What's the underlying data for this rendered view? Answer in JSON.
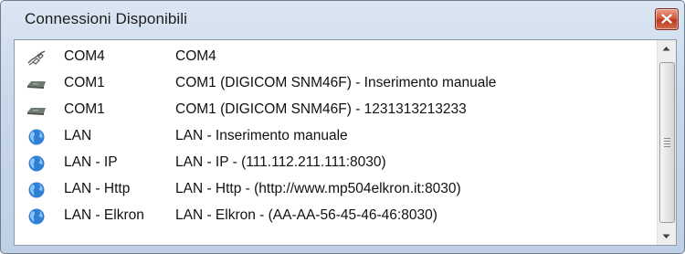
{
  "window": {
    "title": "Connessioni Disponibili",
    "close_icon": "close-icon"
  },
  "connections": [
    {
      "icon": "plug-icon",
      "name": "COM4",
      "description": "COM4"
    },
    {
      "icon": "modem-icon",
      "name": "COM1",
      "description": "COM1 (DIGICOM SNM46F) - Inserimento manuale"
    },
    {
      "icon": "modem-icon",
      "name": "COM1",
      "description": "COM1 (DIGICOM SNM46F) - 1231313213233"
    },
    {
      "icon": "globe-icon",
      "name": "LAN",
      "description": "LAN - Inserimento manuale"
    },
    {
      "icon": "globe-icon",
      "name": "LAN - IP",
      "description": "LAN - IP - (111.112.211.111:8030)"
    },
    {
      "icon": "globe-icon",
      "name": "LAN - Http",
      "description": "LAN - Http - (http://www.mp504elkron.it:8030)"
    },
    {
      "icon": "globe-icon",
      "name": "LAN - Elkron",
      "description": "LAN - Elkron - (AA-AA-56-45-46-46:8030)"
    }
  ],
  "colors": {
    "titlebar": "#c9d8ea",
    "close_button": "#c8452a",
    "globe": "#2f7fd6"
  }
}
